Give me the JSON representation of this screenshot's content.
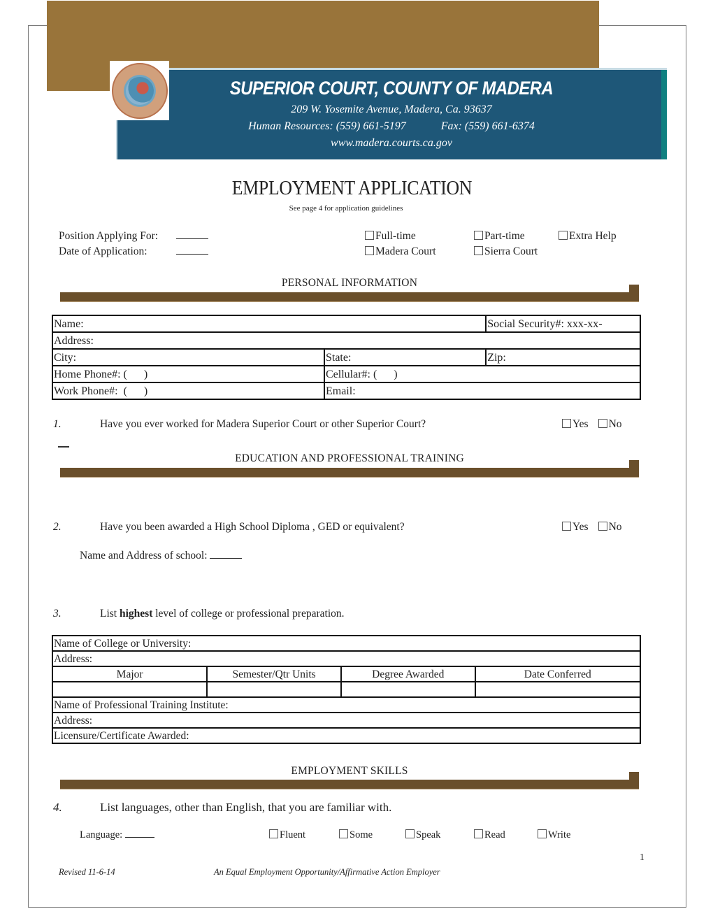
{
  "header": {
    "court_name": "SUPERIOR COURT, COUNTY OF MADERA",
    "address": "209 W. Yosemite Avenue, Madera, Ca. 93637",
    "hr_phone": "Human Resources: (559) 661-5197",
    "fax": "Fax: (559) 661-6374",
    "website": "www.madera.courts.ca.gov",
    "seal_icon": "california-state-seal",
    "colors": {
      "gold": "#99743a",
      "blue": "#1e5778",
      "teal": "#0f8080",
      "section_bar": "#6a4f2b"
    }
  },
  "title": "EMPLOYMENT APPLICATION",
  "subtitle": "See page 4 for application guidelines",
  "top_fields": {
    "position_label": "Position Applying For:",
    "position_value": "",
    "date_label": "Date of Application:",
    "date_value": "",
    "employment_type_options": [
      "Full-time",
      "Part-time",
      "Extra Help"
    ],
    "court_options": [
      "Madera Court",
      "Sierra Court"
    ]
  },
  "sections": {
    "personal": "PERSONAL INFORMATION",
    "education": "EDUCATION AND PROFESSIONAL TRAINING",
    "skills": "EMPLOYMENT SKILLS"
  },
  "personal_table": {
    "name": "Name:",
    "ssn": "Social Security#: xxx-xx-",
    "address": "Address:",
    "city": "City:",
    "state": "State:",
    "zip": "Zip:",
    "home_phone": "Home Phone#: (      )",
    "cellular": "Cellular#: (      )",
    "work_phone": "Work Phone#:  (      )",
    "email": "Email:"
  },
  "questions": [
    {
      "number": "1.",
      "text": "Have you ever worked for Madera Superior Court or other Superior Court?",
      "options": [
        "Yes",
        "No"
      ]
    },
    {
      "number": "2.",
      "text": "Have you been awarded a High School Diploma , GED or equivalent?",
      "options": [
        "Yes",
        "No"
      ],
      "school_label": "Name and Address of school:"
    },
    {
      "number": "3.",
      "text_pre": "List ",
      "text_bold": "highest",
      "text_post": " level of college or professional preparation."
    },
    {
      "number": "4.",
      "text": "List languages, other than English, that you are familiar with."
    }
  ],
  "education_table": {
    "college": "Name of College or University:",
    "college_address": "Address:",
    "columns": [
      "Major",
      "Semester/Qtr Units",
      "Degree Awarded",
      "Date Conferred"
    ],
    "institute": "Name of Professional Training Institute:",
    "institute_address": "Address:",
    "licensure": "Licensure/Certificate Awarded:"
  },
  "languages": {
    "label": "Language:",
    "value": "",
    "options": [
      "Fluent",
      "Some",
      "Speak",
      "Read",
      "Write"
    ]
  },
  "footer": {
    "page_number": "1",
    "revised": "Revised 11-6-14",
    "eeo": "An Equal Employment Opportunity/Affirmative Action Employer"
  }
}
